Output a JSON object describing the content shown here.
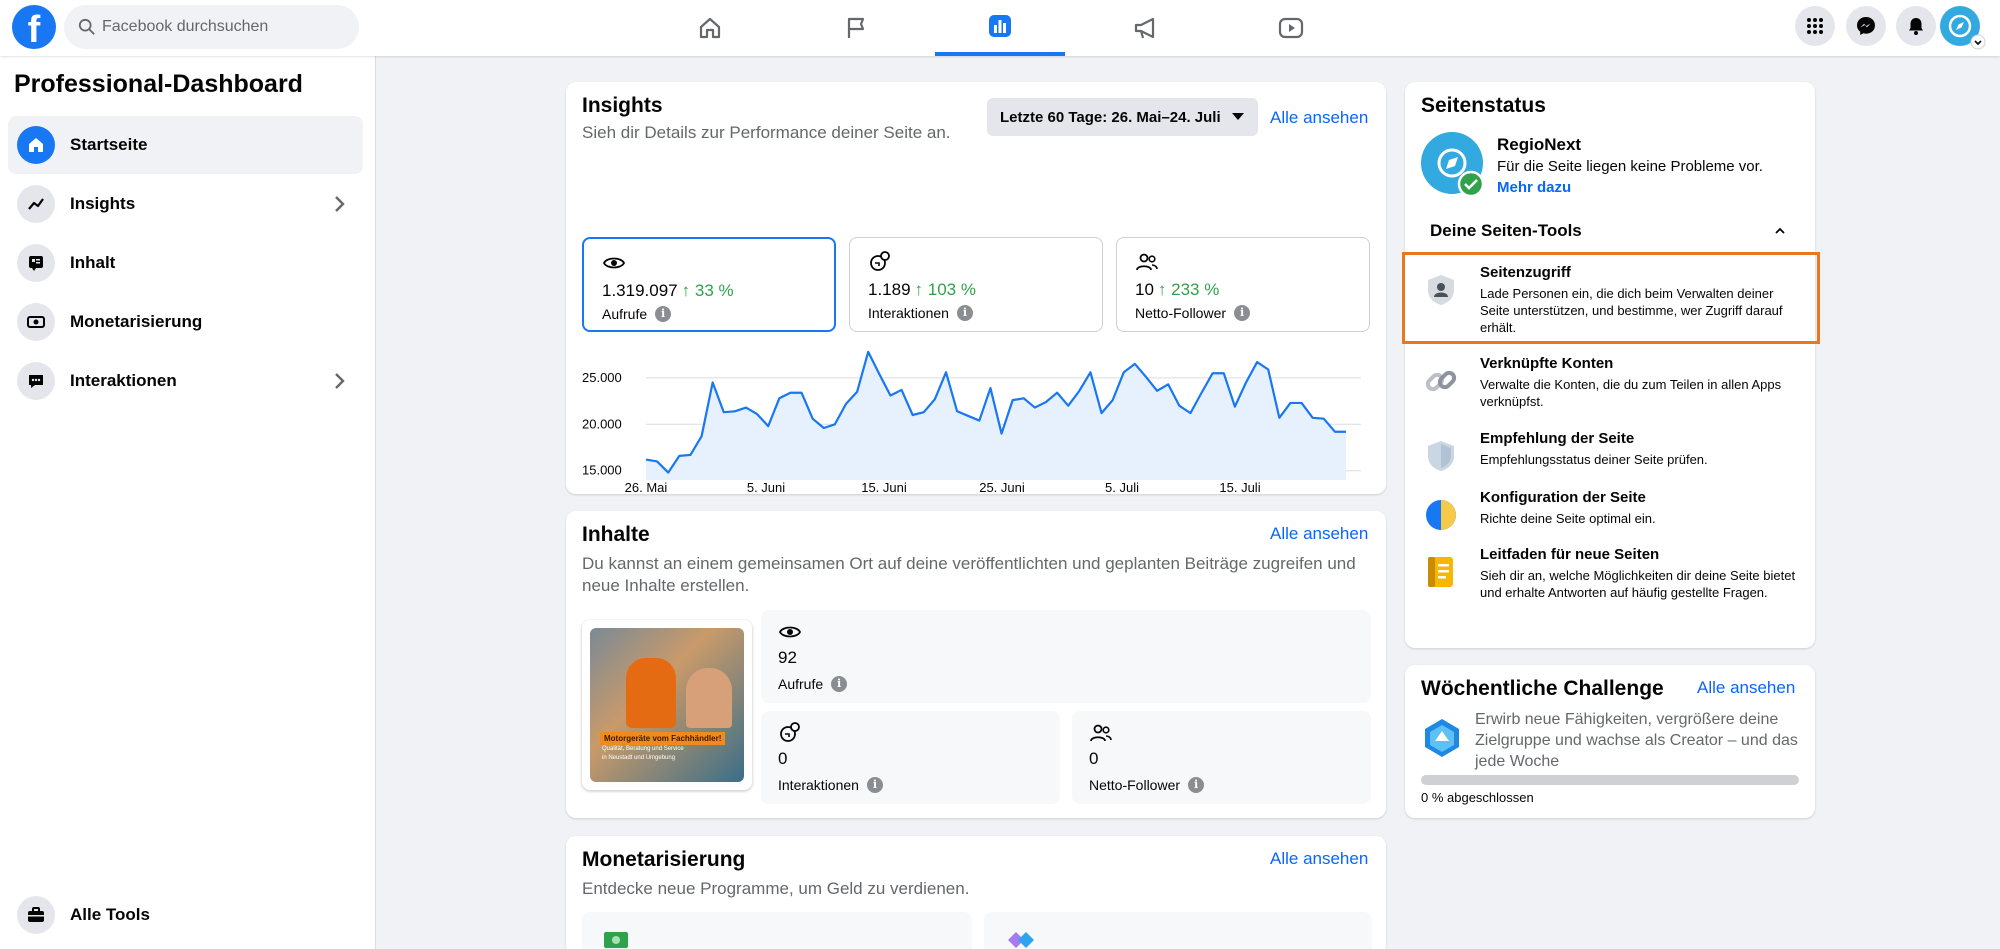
{
  "topbar": {
    "logo_letter": "f",
    "search_placeholder": "Facebook durchsuchen",
    "nav_tabs": [
      {
        "icon": "home-icon"
      },
      {
        "icon": "flag-icon"
      },
      {
        "icon": "bar-chart-icon",
        "active": true
      },
      {
        "icon": "megaphone-icon"
      },
      {
        "icon": "video-play-icon"
      }
    ],
    "right_buttons": [
      "menu-grid-icon",
      "messenger-icon",
      "bell-icon",
      "profile-avatar"
    ],
    "accent_color": "#1877f2"
  },
  "sidebar": {
    "title": "Professional-Dashboard",
    "items": [
      {
        "label": "Startseite",
        "icon": "home-icon",
        "active": true
      },
      {
        "label": "Insights",
        "icon": "trend-line-icon",
        "has_chevron": true
      },
      {
        "label": "Inhalt",
        "icon": "content-icon"
      },
      {
        "label": "Monetarisierung",
        "icon": "money-icon"
      },
      {
        "label": "Interaktionen",
        "icon": "chat-bubble-icon",
        "has_chevron": true
      }
    ],
    "bottom_item": {
      "label": "Alle Tools",
      "icon": "toolbox-icon"
    }
  },
  "insights": {
    "title": "Insights",
    "subtitle": "Sieh dir Details zur Performance deiner Seite an.",
    "date_range": "Letzte 60 Tage: 26. Mai–24. Juli",
    "see_all": "Alle ansehen",
    "metrics": [
      {
        "value": "1.319.097",
        "trend": "↑ 33 %",
        "label": "Aufrufe",
        "icon": "eye-icon",
        "active": true
      },
      {
        "value": "1.189",
        "trend": "↑ 103 %",
        "label": "Interaktionen",
        "icon": "interaction-icon"
      },
      {
        "value": "10",
        "trend": "↑ 233 %",
        "label": "Netto-Follower",
        "icon": "people-icon"
      }
    ]
  },
  "chart_data": {
    "type": "area",
    "title": "",
    "xlabel": "",
    "ylabel": "",
    "x_tick_labels": [
      "26. Mai",
      "5. Juni",
      "15. Juni",
      "25. Juni",
      "5. Juli",
      "15. Juli"
    ],
    "y_tick_labels": [
      "15.000",
      "20.000",
      "25.000"
    ],
    "ylim": [
      14000,
      28000
    ],
    "grid": true,
    "color": "#1877f2",
    "x": [
      "26. Mai",
      "27. Mai",
      "28. Mai",
      "29. Mai",
      "30. Mai",
      "31. Mai",
      "1. Juni",
      "2. Juni",
      "3. Juni",
      "4. Juni",
      "5. Juni",
      "6. Juni",
      "7. Juni",
      "8. Juni",
      "9. Juni",
      "10. Juni",
      "11. Juni",
      "12. Juni",
      "13. Juni",
      "14. Juni",
      "15. Juni",
      "16. Juni",
      "17. Juni",
      "18. Juni",
      "19. Juni",
      "20. Juni",
      "21. Juni",
      "22. Juni",
      "23. Juni",
      "24. Juni",
      "25. Juni",
      "26. Juni",
      "27. Juni",
      "28. Juni",
      "29. Juni",
      "30. Juni",
      "1. Juli",
      "2. Juli",
      "3. Juli",
      "4. Juli",
      "5. Juli",
      "6. Juli",
      "7. Juli",
      "8. Juli",
      "9. Juli",
      "10. Juli",
      "11. Juli",
      "12. Juli",
      "13. Juli",
      "14. Juli",
      "15. Juli",
      "16. Juli",
      "17. Juli",
      "18. Juli",
      "19. Juli",
      "20. Juli",
      "21. Juli",
      "22. Juli",
      "23. Juli",
      "24. Juli"
    ],
    "values": [
      16200,
      16000,
      14800,
      16600,
      16700,
      18700,
      24500,
      21300,
      21400,
      21800,
      21100,
      19800,
      22800,
      23400,
      23400,
      20600,
      19600,
      20000,
      22200,
      23500,
      27800,
      25400,
      23100,
      23700,
      21000,
      21300,
      22700,
      25600,
      21400,
      20900,
      20400,
      23900,
      19000,
      22600,
      22800,
      21800,
      22400,
      23400,
      22000,
      23600,
      25600,
      21200,
      22600,
      25600,
      26500,
      25100,
      23600,
      24300,
      22000,
      21200,
      23400,
      25500,
      25500,
      21900,
      24500,
      26700,
      25900,
      20700,
      22300,
      22300,
      20700,
      20600,
      19200,
      19200
    ]
  },
  "inhalte": {
    "title": "Inhalte",
    "see_all": "Alle ansehen",
    "subtitle": "Du kannst an einem gemeinsamen Ort auf deine veröffentlichten und geplanten Beiträge zugreifen und neue Inhalte erstellen.",
    "thumb_caption": "Motorgeräte vom Fachhändler!",
    "thumb_sub": "Qualität, Beratung und Service",
    "thumb_sub2": "in Neustadt und Umgebung",
    "stats": [
      {
        "value": "92",
        "label": "Aufrufe",
        "icon": "eye-icon"
      },
      {
        "value": "0",
        "label": "Interaktionen",
        "icon": "interaction-icon"
      },
      {
        "value": "0",
        "label": "Netto-Follower",
        "icon": "people-icon"
      }
    ]
  },
  "monetarisierung": {
    "title": "Monetarisierung",
    "see_all": "Alle ansehen",
    "subtitle": "Entdecke neue Programme, um Geld zu verdienen."
  },
  "seitenstatus": {
    "title": "Seitenstatus",
    "page_name": "RegioNext",
    "status_text": "Für die Seite liegen keine Probleme vor.",
    "more_link": "Mehr dazu",
    "tools_header": "Deine Seiten-Tools",
    "tools": [
      {
        "title": "Seitenzugriff",
        "desc": "Lade Personen ein, die dich beim Verwalten deiner Seite unterstützen, und bestimme, wer Zugriff darauf erhält.",
        "icon": "person-shield-icon",
        "highlighted": true
      },
      {
        "title": "Verknüpfte Konten",
        "desc": "Verwalte die Konten, die du zum Teilen in allen Apps verknüpfst.",
        "icon": "link-chain-icon"
      },
      {
        "title": "Empfehlung der Seite",
        "desc": "Empfehlungsstatus deiner Seite prüfen.",
        "icon": "shield-icon"
      },
      {
        "title": "Konfiguration der Seite",
        "desc": "Richte deine Seite optimal ein.",
        "icon": "pie-config-icon"
      },
      {
        "title": "Leitfaden für neue Seiten",
        "desc": "Sieh dir an, welche Möglichkeiten dir deine Seite bietet und erhalte Antworten auf häufig gestellte Fragen.",
        "icon": "guide-book-icon"
      }
    ]
  },
  "challenge": {
    "title": "Wöchentliche Challenge",
    "see_all": "Alle ansehen",
    "text": "Erwirb neue Fähigkeiten, vergrößere deine Zielgruppe und wachse als Creator – und das jede Woche",
    "progress": 0,
    "progress_label": "0 % abgeschlossen"
  }
}
